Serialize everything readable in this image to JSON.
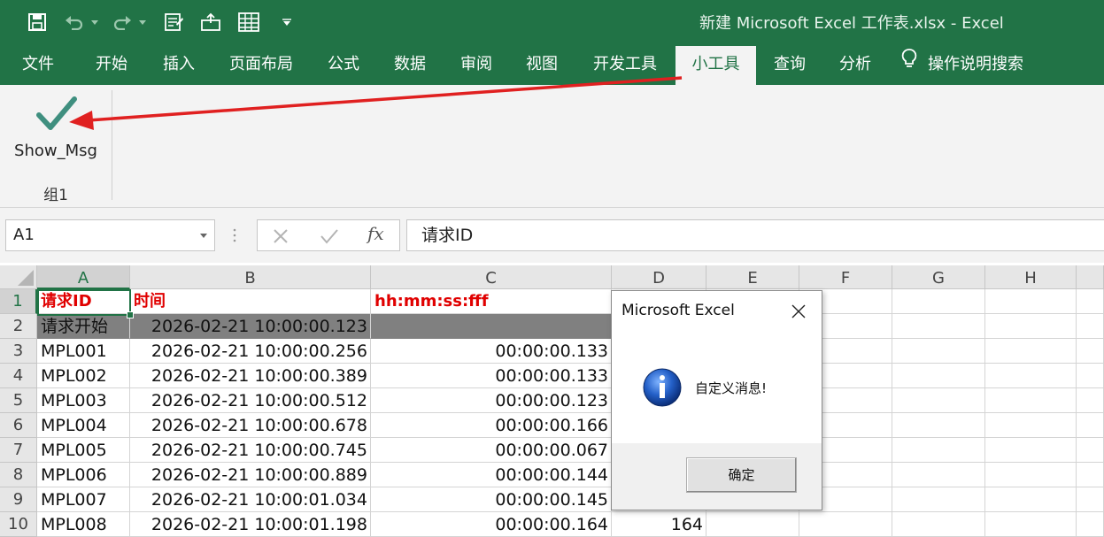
{
  "window": {
    "title": "新建 Microsoft Excel 工作表.xlsx  -  Excel"
  },
  "ribbon_tabs": [
    "文件",
    "开始",
    "插入",
    "页面布局",
    "公式",
    "数据",
    "审阅",
    "视图",
    "开发工具",
    "小工具",
    "查询",
    "分析",
    "操作说明搜索"
  ],
  "active_tab": "小工具",
  "ribbon": {
    "button_label": "Show_Msg",
    "group_label": "组1"
  },
  "formula_bar": {
    "name_box": "A1",
    "fx": "fx",
    "content": "请求ID"
  },
  "columns": [
    "A",
    "B",
    "C",
    "D",
    "E",
    "F",
    "G",
    "H"
  ],
  "rows": [
    {
      "num": "1",
      "cells": [
        "请求ID",
        "时间",
        "hh:mm:ss:fff",
        "",
        "",
        "",
        "",
        ""
      ]
    },
    {
      "num": "2",
      "cells": [
        "请求开始",
        "2026-02-21 10:00:00.123",
        "",
        "",
        "",
        "",
        "",
        ""
      ]
    },
    {
      "num": "3",
      "cells": [
        "MPL001",
        "2026-02-21 10:00:00.256",
        "00:00:00.133",
        "",
        "",
        "",
        "",
        ""
      ]
    },
    {
      "num": "4",
      "cells": [
        "MPL002",
        "2026-02-21 10:00:00.389",
        "00:00:00.133",
        "",
        "",
        "",
        "",
        ""
      ]
    },
    {
      "num": "5",
      "cells": [
        "MPL003",
        "2026-02-21 10:00:00.512",
        "00:00:00.123",
        "",
        "",
        "",
        "",
        ""
      ]
    },
    {
      "num": "6",
      "cells": [
        "MPL004",
        "2026-02-21 10:00:00.678",
        "00:00:00.166",
        "",
        "",
        "",
        "",
        ""
      ]
    },
    {
      "num": "7",
      "cells": [
        "MPL005",
        "2026-02-21 10:00:00.745",
        "00:00:00.067",
        "",
        "",
        "",
        "",
        ""
      ]
    },
    {
      "num": "8",
      "cells": [
        "MPL006",
        "2026-02-21 10:00:00.889",
        "00:00:00.144",
        "",
        "",
        "",
        "",
        ""
      ]
    },
    {
      "num": "9",
      "cells": [
        "MPL007",
        "2026-02-21 10:00:01.034",
        "00:00:00.145",
        "",
        "",
        "",
        "",
        ""
      ]
    },
    {
      "num": "10",
      "cells": [
        "MPL008",
        "2026-02-21 10:00:01.198",
        "00:00:00.164",
        "164",
        "",
        "",
        "",
        ""
      ]
    }
  ],
  "dialog": {
    "title": "Microsoft Excel",
    "message": "自定义消息!",
    "ok_label": "确定"
  },
  "colors": {
    "excel_green": "#217346",
    "annotation_red": "#e02020",
    "header_red": "#e00000",
    "row2_fill": "#808080",
    "check_teal": "#3f8f7f"
  }
}
